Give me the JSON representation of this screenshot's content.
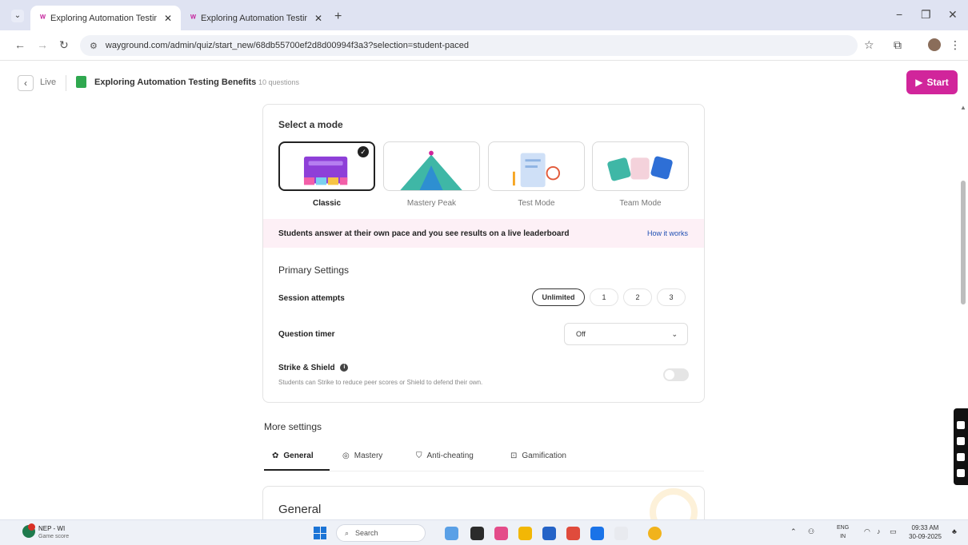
{
  "browser": {
    "tabs": [
      {
        "title": "Exploring Automation Testing",
        "active": true
      },
      {
        "title": "Exploring Automation Testing",
        "active": false
      }
    ],
    "url": "wayground.com/admin/quiz/start_new/68db55700ef2d8d00994f3a3?selection=student-paced"
  },
  "header": {
    "back_label": "Live",
    "quiz_title": "Exploring Automation Testing Benefits",
    "question_count": "10 questions",
    "start_label": "Start"
  },
  "mode_card": {
    "title": "Select a mode",
    "modes": [
      {
        "label": "Classic",
        "selected": true
      },
      {
        "label": "Mastery Peak",
        "selected": false
      },
      {
        "label": "Test Mode",
        "selected": false
      },
      {
        "label": "Team Mode",
        "selected": false
      }
    ],
    "info_text": "Students answer at their own pace and you see results on a live leaderboard",
    "how_it_works": "How it works",
    "primary_title": "Primary Settings",
    "session_attempts_label": "Session attempts",
    "attempt_options": [
      "Unlimited",
      "1",
      "2",
      "3"
    ],
    "question_timer_label": "Question timer",
    "question_timer_value": "Off",
    "strike_label": "Strike & Shield",
    "strike_desc": "Students can Strike to reduce peer scores or Shield to defend their own.",
    "strike_enabled": false
  },
  "more_settings": {
    "title": "More settings",
    "tabs": [
      "General",
      "Mastery",
      "Anti-cheating",
      "Gamification"
    ],
    "active_tab": "General",
    "section_title": "General"
  },
  "taskbar": {
    "weather_line1": "NEP - WI",
    "weather_line2": "Game score",
    "search_placeholder": "Search",
    "lang_line1": "ENG",
    "lang_line2": "IN",
    "time": "09:33 AM",
    "date": "30-09-2025"
  },
  "colors": {
    "accent": "#d1259b",
    "info_strip": "#fdf0f6",
    "link": "#1f4fb3"
  }
}
